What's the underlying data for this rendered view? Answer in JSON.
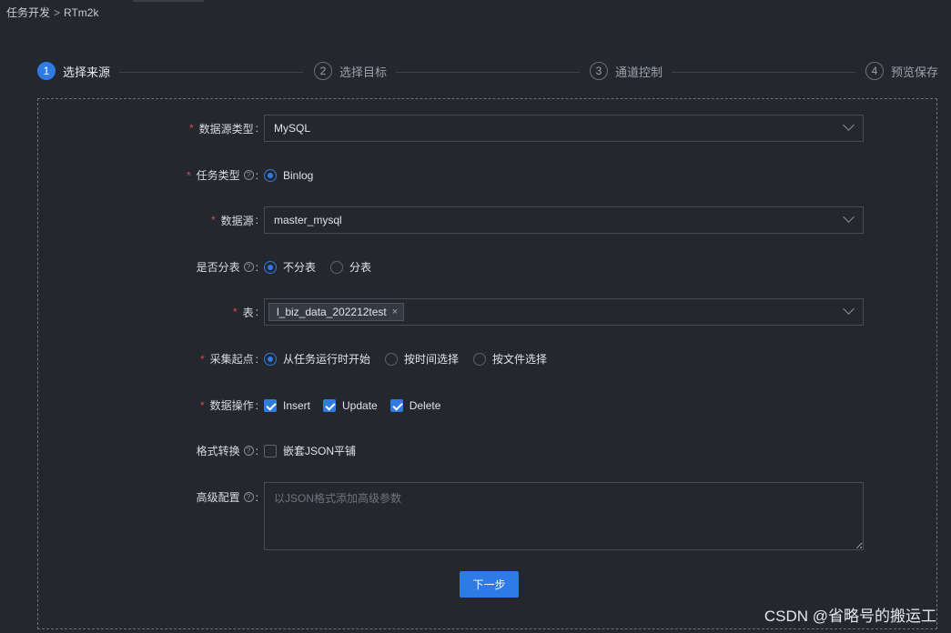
{
  "breadcrumb": {
    "parent": "任务开发",
    "separator": ">",
    "current": "RTm2k"
  },
  "steps": [
    {
      "num": "1",
      "label": "选择来源"
    },
    {
      "num": "2",
      "label": "选择目标"
    },
    {
      "num": "3",
      "label": "通道控制"
    },
    {
      "num": "4",
      "label": "预览保存"
    }
  ],
  "form": {
    "source_type": {
      "label": "数据源类型",
      "value": "MySQL"
    },
    "task_type": {
      "label": "任务类型",
      "option": "Binlog"
    },
    "datasource": {
      "label": "数据源",
      "value": "master_mysql"
    },
    "sharding": {
      "label": "是否分表",
      "opt_no": "不分表",
      "opt_yes": "分表"
    },
    "table": {
      "label": "表",
      "tag": "l_biz_data_202212test",
      "tag_close": "×"
    },
    "start_point": {
      "label": "采集起点",
      "opt1": "从任务运行时开始",
      "opt2": "按时间选择",
      "opt3": "按文件选择"
    },
    "data_ops": {
      "label": "数据操作",
      "insert": "Insert",
      "update": "Update",
      "delete": "Delete"
    },
    "format": {
      "label": "格式转换",
      "option": "嵌套JSON平铺"
    },
    "advanced": {
      "label": "高级配置",
      "placeholder": "以JSON格式添加高级参数"
    },
    "colon": ":",
    "required_mark": "*",
    "help_glyph": "?"
  },
  "next_button": "下一步",
  "watermark": "CSDN @省略号的搬运工",
  "colors": {
    "accent": "#2f7be6",
    "background": "#24272e",
    "required": "#e0494a"
  }
}
